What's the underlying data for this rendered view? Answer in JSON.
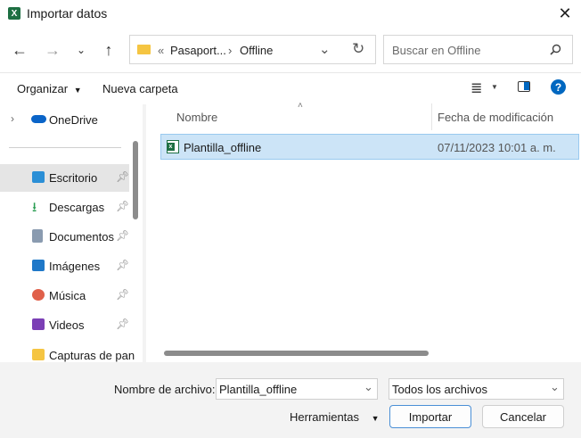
{
  "window": {
    "title": "Importar datos",
    "app_badge": "X"
  },
  "nav": {
    "path_prefix": "«",
    "path": [
      "Pasaport...",
      "Offline"
    ],
    "path_sep": "›",
    "search_placeholder": "Buscar en Offline"
  },
  "toolbar": {
    "organize": "Organizar",
    "new_folder": "Nueva carpeta"
  },
  "sidebar": {
    "onedrive": "OneDrive",
    "items": [
      {
        "label": "Escritorio",
        "icon": "desktop-icon",
        "color": "#2b8fd6"
      },
      {
        "label": "Descargas",
        "icon": "download-icon",
        "color": "#2a9d52"
      },
      {
        "label": "Documentos",
        "icon": "document-icon",
        "color": "#8a9bb0"
      },
      {
        "label": "Imágenes",
        "icon": "picture-icon",
        "color": "#1f78c8"
      },
      {
        "label": "Música",
        "icon": "music-icon",
        "color": "#e0604a"
      },
      {
        "label": "Videos",
        "icon": "video-icon",
        "color": "#7b3fb5"
      },
      {
        "label": "Capturas de pan",
        "icon": "folder-icon",
        "color": "#f5c542"
      }
    ]
  },
  "columns": {
    "name": "Nombre",
    "modified": "Fecha de modificación"
  },
  "files": [
    {
      "name": "Plantilla_offline",
      "modified": "07/11/2023 10:01 a. m."
    }
  ],
  "footer": {
    "filename_label": "Nombre de archivo:",
    "filename_value": "Plantilla_offline",
    "filter": "Todos los archivos",
    "tools": "Herramientas",
    "import": "Importar",
    "cancel": "Cancelar"
  },
  "colors": {
    "accent": "#0067c0",
    "selection": "#cce4f7",
    "excel": "#1d6f42"
  }
}
